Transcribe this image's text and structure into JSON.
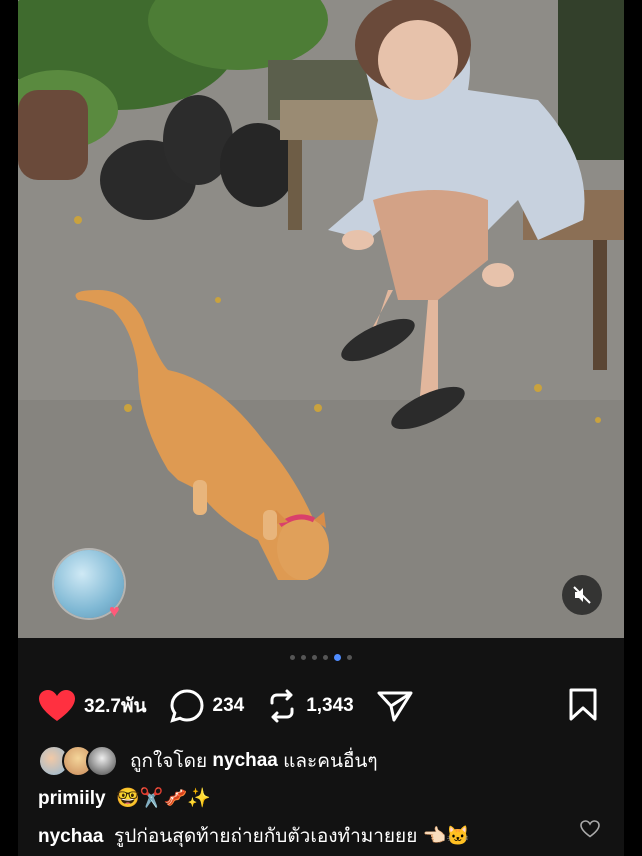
{
  "post": {
    "likes": "32.7พัน",
    "comments": "234",
    "reposts": "1,343",
    "carousel": {
      "total": 6,
      "active_index": 4
    }
  },
  "liked_by": {
    "prefix": "ถูกใจโดย",
    "user": "nychaa",
    "suffix": "และคนอื่นๆ"
  },
  "caption": {
    "user": "primiily",
    "text": "🤓✂️🥓✨"
  },
  "top_comment": {
    "user": "nychaa",
    "text": "รูปก่อนสุดท้ายถ่ายกับตัวเองทำมายยย 👈🏻🐱"
  },
  "colors": {
    "like": "#ff3040",
    "accent_dot": "#4f8cff",
    "background": "#121212"
  },
  "icons": [
    "heart-icon",
    "comment-icon",
    "repost-icon",
    "share-icon",
    "bookmark-icon",
    "mute-icon",
    "comment-like-icon"
  ]
}
